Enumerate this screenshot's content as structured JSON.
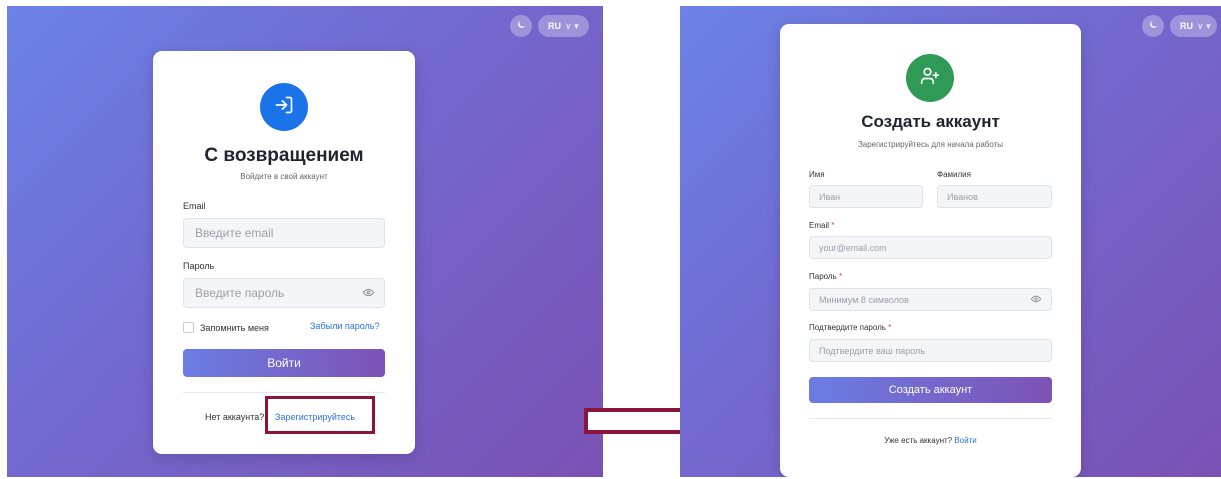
{
  "login": {
    "theme_icon": "moon-icon",
    "language": "RU",
    "language_chevron": "∨ ▾",
    "avatar_icon": "login-icon",
    "avatar_color": "#1a73e8",
    "title": "С возвращением",
    "subtitle": "Войдите в свой аккаунт",
    "email_label": "Email",
    "email_placeholder": "Введите email",
    "password_label": "Пароль",
    "password_placeholder": "Введите пароль",
    "remember_label": "Запомнить меня",
    "forgot_link": "Забыли пароль?",
    "submit_label": "Войти",
    "no_account_text": "Нет аккаунта?",
    "register_link": "Зарегистрируйтесь"
  },
  "register": {
    "theme_icon": "moon-icon",
    "language": "RU",
    "language_chevron": "∨ ▾",
    "avatar_icon": "add-user-icon",
    "avatar_color": "#2e9a55",
    "title": "Создать аккаунт",
    "subtitle": "Зарегистрируйтесь для начала работы",
    "first_name_label": "Имя",
    "first_name_placeholder": "Иван",
    "last_name_label": "Фамилия",
    "last_name_placeholder": "Иванов",
    "email_label": "Email",
    "email_placeholder": "your@email.com",
    "password_label": "Пароль",
    "password_placeholder": "Минимум 8 символов",
    "confirm_label": "Подтвердите пароль",
    "confirm_placeholder": "Подтвердите ваш пароль",
    "required_mark": "*",
    "submit_label": "Создать аккаунт",
    "have_account_text": "Уже есть аккаунт?",
    "login_link": "Войти"
  },
  "annotation": {
    "highlight_color": "#8b1538",
    "arrow_color": "#8b1538",
    "arrow_icon": "right-arrow-icon"
  }
}
